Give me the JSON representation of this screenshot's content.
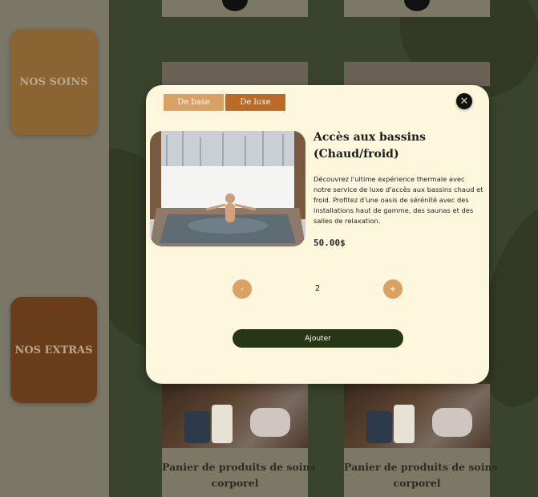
{
  "sidebar": {
    "categories": [
      {
        "label": "NOS SOINS"
      },
      {
        "label": "NOS EXTRAS"
      }
    ]
  },
  "products": {
    "bottom_cards": [
      {
        "title_line1": "Panier de produits de soins",
        "title_line2": "corporel"
      },
      {
        "title_line1": "Panier de produits de soins",
        "title_line2": "corporel"
      }
    ]
  },
  "modal": {
    "tabs": [
      {
        "label": "De base"
      },
      {
        "label": "De luxe",
        "active": true
      }
    ],
    "close_icon": "close-icon",
    "title_line1": "Accès aux bassins",
    "title_line2": "(Chaud/froid)",
    "description": "Découvrez l'ultime expérience thermale avec notre service de luxe d'accès aux bassins chaud et froid. Profitez d'une oasis de sérénité avec des installations haut de gamme, des saunas et des salles de relaxation.",
    "price": "50.00$",
    "quantity": {
      "minus": "-",
      "value": "2",
      "plus": "+"
    },
    "add_label": "Ajouter"
  },
  "colors": {
    "modal_bg": "#fdf7dd",
    "tab_base": "#d9a265",
    "tab_luxe": "#b96a26",
    "qty_button": "#dba363",
    "add_button": "#283618"
  }
}
